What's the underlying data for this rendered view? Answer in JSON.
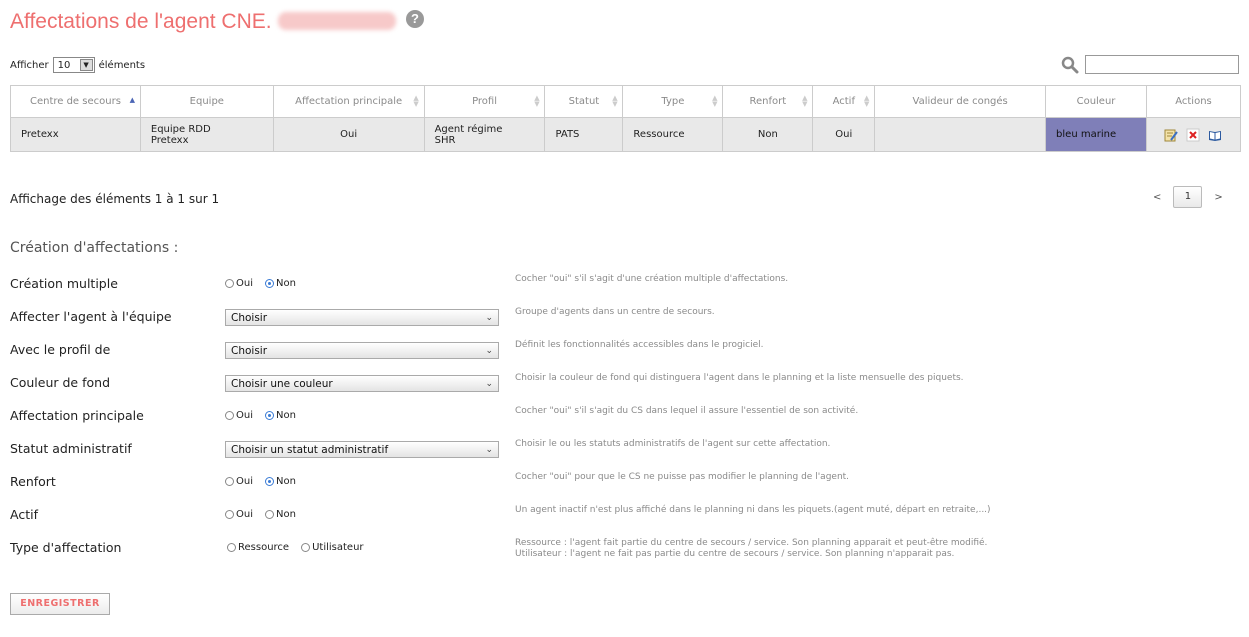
{
  "page": {
    "title": "Affectations de l'agent CNE.",
    "help": "?"
  },
  "length": {
    "prefix": "Afficher",
    "value": "10",
    "suffix": "éléments"
  },
  "table": {
    "headers": [
      "Centre de secours",
      "Equipe",
      "Affectation principale",
      "Profil",
      "Statut",
      "Type",
      "Renfort",
      "Actif",
      "Valideur de congés",
      "Couleur",
      "Actions"
    ],
    "row": {
      "centre": "Pretexx",
      "equipe_l1": "Equipe RDD",
      "equipe_l2": "Pretexx",
      "principale": "Oui",
      "profil_l1": "Agent régime",
      "profil_l2": "SHR",
      "statut": "PATS",
      "type": "Ressource",
      "renfort": "Non",
      "actif": "Oui",
      "valideur": "",
      "couleur": "bleu marine"
    },
    "row_color": "#7f7fb8"
  },
  "info": "Affichage des éléments 1 à 1 sur 1",
  "pager": {
    "prev": "<",
    "page": "1",
    "next": ">"
  },
  "form": {
    "section_title": "Création d'affectations :",
    "multiple": {
      "label": "Création multiple",
      "oui": "Oui",
      "non": "Non",
      "hint": "Cocher \"oui\" s'il s'agit d'une création multiple d'affectations."
    },
    "equipe": {
      "label": "Affecter l'agent à l'équipe",
      "value": "Choisir",
      "hint": "Groupe d'agents dans un centre de secours."
    },
    "profil": {
      "label": "Avec le profil de",
      "value": "Choisir",
      "hint": "Définit les fonctionnalités accessibles dans le progiciel."
    },
    "couleur": {
      "label": "Couleur de fond",
      "value": "Choisir une couleur",
      "hint": "Choisir la couleur de fond qui distinguera l'agent dans le planning et la liste mensuelle des piquets."
    },
    "principale": {
      "label": "Affectation principale",
      "oui": "Oui",
      "non": "Non",
      "hint": "Cocher \"oui\" s'il s'agit du CS dans lequel il assure l'essentiel de son activité."
    },
    "statut": {
      "label": "Statut administratif",
      "value": "Choisir un statut administratif",
      "hint": "Choisir le ou les statuts administratifs de l'agent sur cette affectation."
    },
    "renfort": {
      "label": "Renfort",
      "oui": "Oui",
      "non": "Non",
      "hint": "Cocher \"oui\" pour que le CS ne puisse pas modifier le planning de l'agent."
    },
    "actif": {
      "label": "Actif",
      "oui": "Oui",
      "non": "Non",
      "hint": "Un agent inactif n'est plus affiché dans le planning ni dans les piquets.(agent muté, départ en retraite,...)"
    },
    "type": {
      "label": "Type d'affectation",
      "ressource": "Ressource",
      "utilisateur": "Utilisateur",
      "hint_l1": "Ressource : l'agent fait partie du centre de secours / service. Son planning apparait et peut-être modifié.",
      "hint_l2": "Utilisateur : l'agent ne fait pas partie du centre de secours / service. Son planning n'apparait pas."
    }
  },
  "save_label": "ENREGISTRER"
}
